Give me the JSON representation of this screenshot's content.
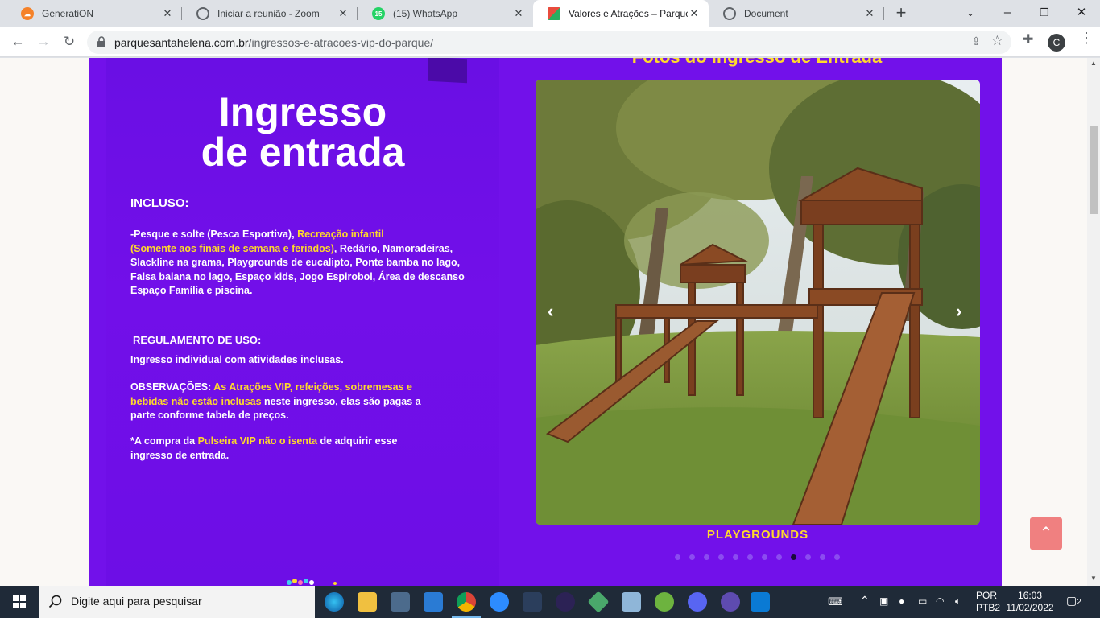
{
  "tabs": [
    {
      "title": "GeneratiON",
      "icon": "cloud-icon",
      "color": "#f5822a"
    },
    {
      "title": "Iniciar a reunião - Zoom",
      "icon": "globe-icon",
      "color": "#5f6368"
    },
    {
      "title": "(15) WhatsApp",
      "icon": "whatsapp-icon",
      "color": "#25d366",
      "badge": "15"
    },
    {
      "title": "Valores e Atrações – Parque Santa Helena",
      "icon": "site-favicon-icon",
      "color": "#d94a4a",
      "active": true
    },
    {
      "title": "Document",
      "icon": "globe-icon",
      "color": "#5f6368"
    }
  ],
  "toolbar": {
    "url_host": "parquesantahelena.com.br",
    "url_path": "/ingressos-e-atracoes-vip-do-parque/",
    "profile_initial": "C"
  },
  "page": {
    "left": {
      "title_line1": "Ingresso",
      "title_line2": "de entrada",
      "incluso_heading": "INCLUSO:",
      "incluso_p1_a": "-Pesque e solte ",
      "incluso_p1_b": "(Pesca Esportiva)",
      "incluso_p1_c": ", ",
      "incluso_p1_d": "Recreação infantil",
      "incluso_p1_e": "(Somente aos finais de semana e feriados)",
      "incluso_p1_f": ", Redário, Namoradeiras, Slackline na grama, Playgrounds de eucalipto, Ponte bamba no lago, Falsa baiana no lago, Espaço kids, Jogo Espirobol, Área de descanso ",
      "incluso_p1_g": "Espaço Família",
      "incluso_p1_h": " e piscina.",
      "regulamento_heading": "REGULAMENTO DE USO:",
      "regulamento_text": "Ingresso individual com atividades inclusas.",
      "obs_a": "OBSERVAÇÕES: ",
      "obs_b": "As Atrações VIP, refeições, sobremesas e bebidas não estão inclusas",
      "obs_c": " neste ingresso, elas são pagas a parte conforme tabela de preços.",
      "compra_a": "*A compra da ",
      "compra_b": "Pulseira VIP",
      "compra_c": " ",
      "compra_d": "não o isenta",
      "compra_e": " de adquirir esse ingresso de entrada."
    },
    "carousel": {
      "title": "Fotos do Ingresso de Entrada",
      "caption": "PLAYGROUNDS",
      "slide_count": 12,
      "active_index": 8
    }
  },
  "taskbar": {
    "search_placeholder": "Digite aqui para pesquisar",
    "lang1": "POR",
    "lang2": "PTB2",
    "time": "16:03",
    "date": "11/02/2022",
    "notifications": "2"
  },
  "colors": {
    "page_purple": "#7211ea",
    "accent_yellow": "#ffd92b",
    "scroll_top_button": "#f08080"
  }
}
